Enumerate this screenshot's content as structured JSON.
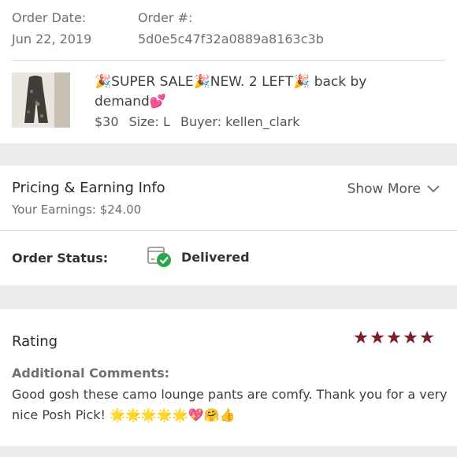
{
  "order": {
    "date_label": "Order Date:",
    "date_value": "Jun 22, 2019",
    "number_label": "Order #:",
    "number_value": "5d0e5c47f32a0889a8163c3b"
  },
  "item": {
    "title_line1": "🎉SUPER SALE🎉NEW. 2 LEFT🎉 back by",
    "title_line2": "demand💕",
    "price": "$30",
    "size": "Size: L",
    "buyer": "Buyer: kellen_clark"
  },
  "pricing": {
    "title": "Pricing & Earning Info",
    "earnings": "Your Earnings: $24.00",
    "show_more": "Show More"
  },
  "status": {
    "label": "Order Status:",
    "value": "Delivered",
    "icon": "delivered-box-check-icon",
    "check_color": "#2fa44f"
  },
  "rating": {
    "label": "Rating",
    "stars": 5,
    "star_color": "#7a2029"
  },
  "comments": {
    "label": "Additional Comments:",
    "text": "Good gosh these camo lounge pants are comfy. Thank you for a very nice Posh Pick! 🌟🌟🌟🌟🌟💖🤗👍"
  }
}
